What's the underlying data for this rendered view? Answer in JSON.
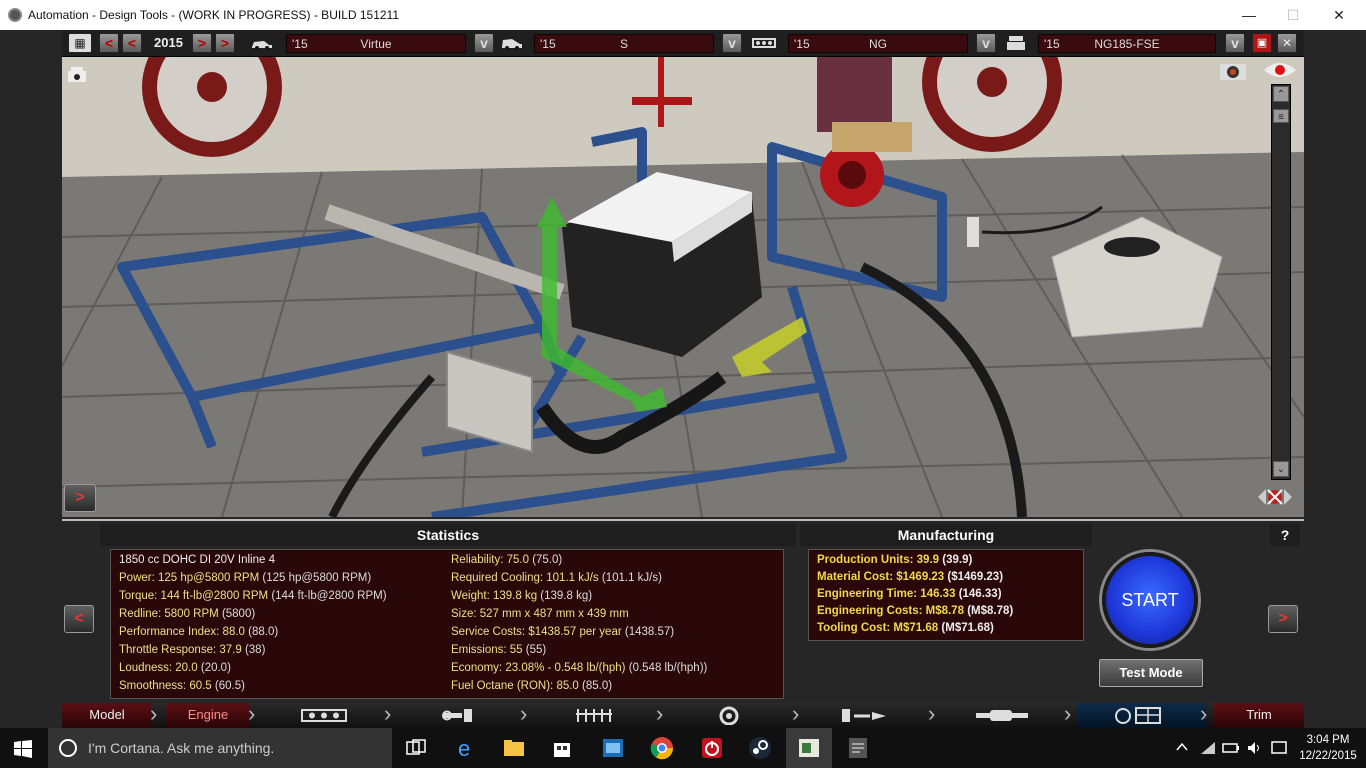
{
  "window": {
    "title": "Automation - Design Tools - (WORK IN PROGRESS) - BUILD 151211",
    "minimize": "—",
    "maximize": "☐",
    "close": "✕"
  },
  "toolbar": {
    "year": "2015",
    "prev1": "<",
    "prev2": "<",
    "next1": ">",
    "next2": ">",
    "model": {
      "year": "'15",
      "name": "Virtue"
    },
    "trim": {
      "year": "'15",
      "name": "S"
    },
    "family": {
      "year": "'15",
      "name": "NG"
    },
    "engine": {
      "year": "'15",
      "name": "NG185-FSE"
    },
    "dropdown": "v"
  },
  "viewport": {
    "panel_toggle": ">"
  },
  "statistics": {
    "title": "Statistics",
    "engine_desc": "1850 cc DOHC DI 20V Inline 4",
    "left": [
      {
        "label": "Power: 125 hp@5800 RPM",
        "paren": "(125 hp@5800 RPM)"
      },
      {
        "label": "Torque: 144 ft-lb@2800 RPM",
        "paren": "(144 ft-lb@2800 RPM)"
      },
      {
        "label": "Redline: 5800 RPM",
        "paren": "(5800)"
      },
      {
        "label": "Performance Index: 88.0",
        "paren": "(88.0)"
      },
      {
        "label": "Throttle Response: 37.9",
        "paren": "(38)"
      },
      {
        "label": "Loudness: 20.0",
        "paren": "(20.0)"
      },
      {
        "label": "Smoothness: 60.5",
        "paren": "(60.5)"
      }
    ],
    "right": [
      {
        "label": "Reliability: 75.0",
        "paren": "(75.0)"
      },
      {
        "label": "Required Cooling: 101.1 kJ/s",
        "paren": "(101.1 kJ/s)"
      },
      {
        "label": "Weight: 139.8 kg",
        "paren": "(139.8 kg)"
      },
      {
        "label": "Size: 527 mm x 487 mm x 439 mm",
        "paren": ""
      },
      {
        "label": "Service Costs: $1438.57 per year",
        "paren": "(1438.57)"
      },
      {
        "label": "Emissions: 55",
        "paren": "(55)"
      },
      {
        "label": "Economy: 23.08% - 0.548 lb/(hph)",
        "paren": "(0.548 lb/(hph))"
      },
      {
        "label": "Fuel Octane (RON): 85.0",
        "paren": "(85.0)"
      }
    ]
  },
  "manufacturing": {
    "title": "Manufacturing",
    "rows": [
      {
        "label": "Production Units: 39.9",
        "paren": "(39.9)"
      },
      {
        "label": "Material Cost: $1469.23",
        "paren": "($1469.23)"
      },
      {
        "label": "Engineering Time: 146.33",
        "paren": "(146.33)"
      },
      {
        "label": "Engineering Costs: M$8.78",
        "paren": "(M$8.78)"
      },
      {
        "label": "Tooling Cost: M$71.68",
        "paren": "(M$71.68)"
      }
    ]
  },
  "actions": {
    "help": "?",
    "start": "START",
    "test_mode": "Test Mode",
    "prev": "<",
    "next": ">"
  },
  "tabs": {
    "model": "Model",
    "engine": "Engine",
    "trim": "Trim"
  },
  "taskbar": {
    "cortana_placeholder": "I'm Cortana. Ask me anything.",
    "time": "3:04 PM",
    "date": "12/22/2015"
  }
}
